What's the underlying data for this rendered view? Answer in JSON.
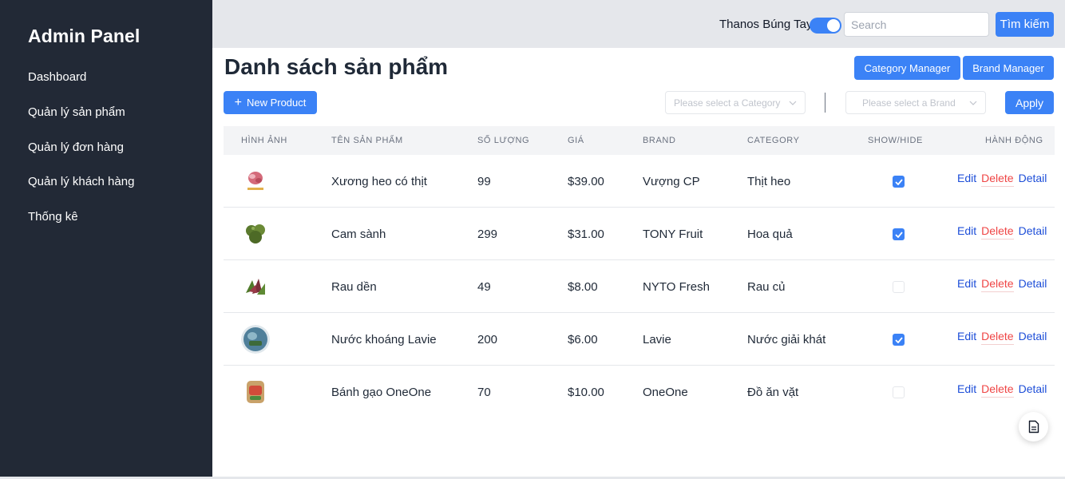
{
  "sidebar": {
    "title": "Admin Panel",
    "items": [
      {
        "label": "Dashboard"
      },
      {
        "label": "Quản lý sản phẩm"
      },
      {
        "label": "Quản lý đơn hàng"
      },
      {
        "label": "Quản lý khách hàng"
      },
      {
        "label": "Thống kê"
      }
    ]
  },
  "topbar": {
    "toggle_label": "Thanos Búng Tay",
    "toggle_on": true,
    "search_placeholder": "Search",
    "search_value": "",
    "search_button": "Tìm kiếm"
  },
  "main": {
    "title": "Danh sách sản phẩm",
    "category_manager_label": "Category Manager",
    "brand_manager_label": "Brand Manager",
    "new_product_label": "New Product",
    "category_select_placeholder": "Please select a Category",
    "brand_select_placeholder": "Please select a Brand",
    "apply_label": "Apply"
  },
  "table": {
    "headers": {
      "image": "HÌNH ẢNH",
      "name": "TÊN SẢN PHẨM",
      "quantity": "SỐ LƯỢNG",
      "price": "GIÁ",
      "brand": "BRAND",
      "category": "CATEGORY",
      "show_hide": "SHOW/HIDE",
      "actions": "HÀNH ĐỘNG"
    },
    "actions": {
      "edit": "Edit",
      "delete": "Delete",
      "detail": "Detail"
    },
    "rows": [
      {
        "name": "Xương heo có thịt",
        "quantity": "99",
        "price": "$39.00",
        "brand": "Vượng CP",
        "category": "Thịt heo",
        "visible": true,
        "thumb": "pork-bone-image"
      },
      {
        "name": "Cam sành",
        "quantity": "299",
        "price": "$31.00",
        "brand": "TONY Fruit",
        "category": "Hoa quả",
        "visible": true,
        "thumb": "orange-image"
      },
      {
        "name": "Rau dền",
        "quantity": "49",
        "price": "$8.00",
        "brand": "NYTO Fresh",
        "category": "Rau củ",
        "visible": false,
        "thumb": "amaranth-image"
      },
      {
        "name": "Nước khoáng Lavie",
        "quantity": "200",
        "price": "$6.00",
        "brand": "Lavie",
        "category": "Nước giải khát",
        "visible": true,
        "thumb": "water-bottle-image"
      },
      {
        "name": "Bánh gạo OneOne",
        "quantity": "70",
        "price": "$10.00",
        "brand": "OneOne",
        "category": "Đồ ăn vặt",
        "visible": false,
        "thumb": "rice-cracker-image"
      }
    ]
  },
  "colors": {
    "primary": "#3b82f6",
    "sidebar_bg": "#222936",
    "delete": "#ef4444",
    "link": "#1d4ed8"
  },
  "icons": {
    "fab": "document-icon",
    "select_arrow": "chevron-down-icon",
    "add": "plus-icon",
    "check": "check-icon"
  }
}
